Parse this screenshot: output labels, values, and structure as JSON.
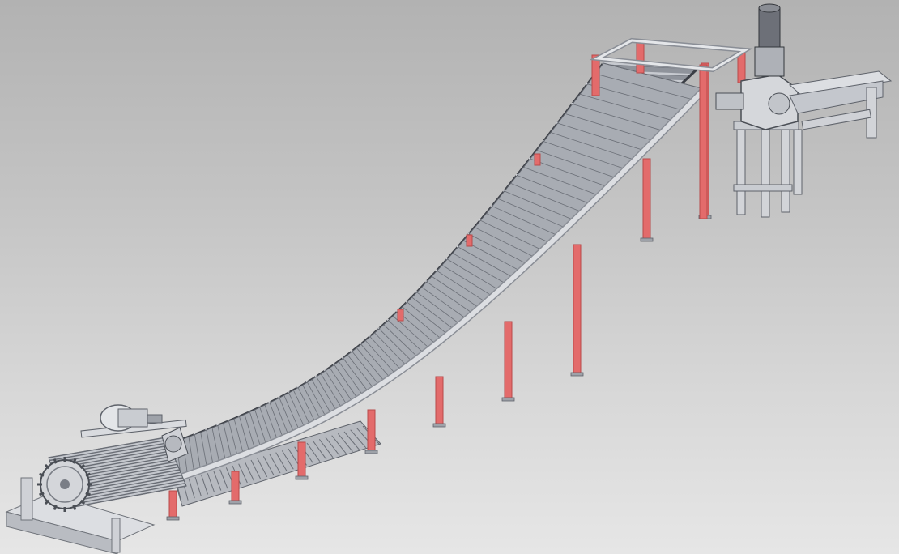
{
  "scene": {
    "subject": "incline-chain-conveyor-cad-render",
    "icons": {
      "motor": "drive-motor-icon",
      "gearbox": "gearbox-icon",
      "sprocket": "sprocket-icon"
    },
    "colors": {
      "background_top": "#b2b2b2",
      "background_bottom": "#e6e6e6",
      "frame_steel": "#dcdee2",
      "frame_shadow": "#8a8e96",
      "chain_dark": "#3c3f46",
      "slat": "#c7cad0",
      "support_leg": "#e36b6b",
      "support_leg_dark": "#b84a4a",
      "motor_body": "#6d7078"
    }
  }
}
